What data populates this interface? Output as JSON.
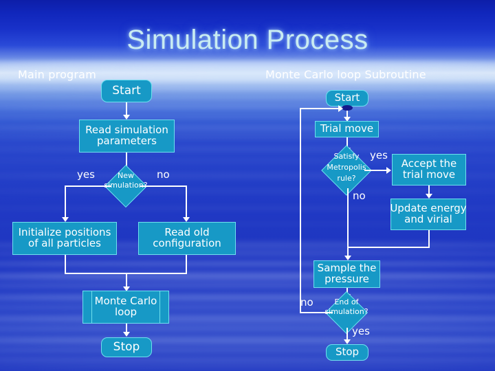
{
  "slide": {
    "title": "Simulation Process",
    "title_color": "#c9ecf2",
    "background": {
      "style": "sky-and-ocean photograph",
      "top_color": "#0d1ea8",
      "horizon_color": "#dce8f8",
      "bottom_color": "#2139c2"
    },
    "node_fill": "#1799c6",
    "node_border": "#6fe0ee",
    "connector_color": "#ffffff",
    "junction_color": "#141a8c"
  },
  "columns": [
    {
      "id": "main",
      "heading": "Main program"
    },
    {
      "id": "subroutine",
      "heading": "Monte Carlo loop Subroutine"
    }
  ],
  "main_program": {
    "heading": "Main program",
    "nodes": {
      "start": {
        "label": "Start",
        "shape": "terminator"
      },
      "read_params": {
        "label_line1": "Read simulation",
        "label_line2": "parameters",
        "shape": "process"
      },
      "new_sim": {
        "label_line1": "New",
        "label_line2": "simulation?",
        "shape": "decision"
      },
      "init_pos": {
        "label_line1": "Initialize positions",
        "label_line2": "of all particles",
        "shape": "process"
      },
      "read_old": {
        "label_line1": "Read old",
        "label_line2": "configuration",
        "shape": "process"
      },
      "mc_loop": {
        "label_line1": "Monte Carlo",
        "label_line2": "loop",
        "shape": "subroutine"
      },
      "stop": {
        "label": "Stop",
        "shape": "terminator"
      }
    },
    "edge_labels": {
      "yes": "yes",
      "no": "no"
    }
  },
  "subroutine": {
    "heading": "Monte Carlo loop Subroutine",
    "nodes": {
      "start": {
        "label": "Start",
        "shape": "terminator"
      },
      "trial_move": {
        "label": "Trial move",
        "shape": "process"
      },
      "metropolis": {
        "label_line1": "Satisfy",
        "label_line2": "Metropolis",
        "label_line3": "rule?",
        "shape": "decision"
      },
      "accept": {
        "label_line1": "Accept the",
        "label_line2": "trial move",
        "shape": "process"
      },
      "update": {
        "label_line1": "Update energy",
        "label_line2": "and virial",
        "shape": "process"
      },
      "sample": {
        "label_line1": "Sample the",
        "label_line2": "pressure",
        "shape": "process"
      },
      "end_sim": {
        "label_line1": "End of",
        "label_line2": "simulation?",
        "shape": "decision"
      },
      "stop": {
        "label": "Stop",
        "shape": "terminator"
      }
    },
    "edge_labels": {
      "yes_metropolis": "yes",
      "no_metropolis": "no",
      "no_end": "no",
      "yes_end": "yes"
    }
  }
}
